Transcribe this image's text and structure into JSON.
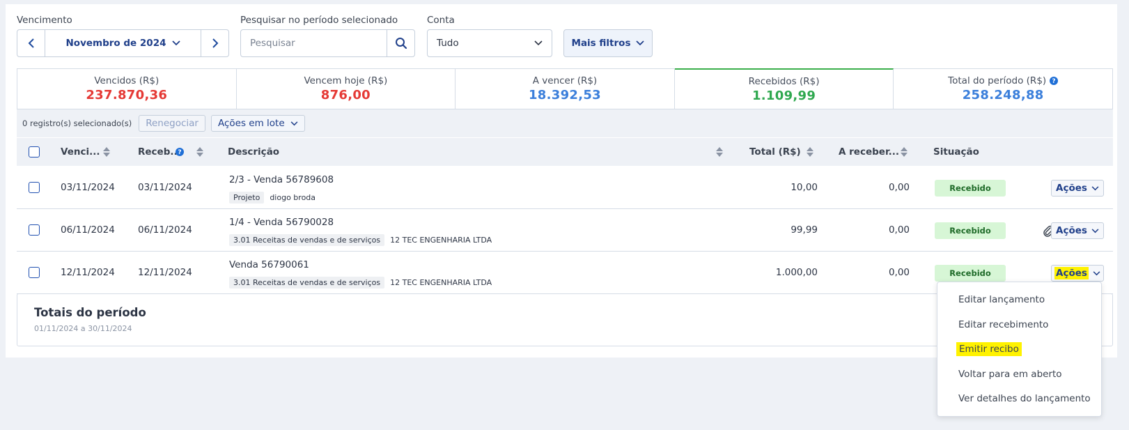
{
  "filters": {
    "vencimento_label": "Vencimento",
    "period_label": "Novembro de 2024",
    "search_label": "Pesquisar no período selecionado",
    "search_placeholder": "Pesquisar",
    "conta_label": "Conta",
    "conta_value": "Tudo",
    "mais_filtros": "Mais filtros"
  },
  "summary": [
    {
      "label": "Vencidos (R$)",
      "value": "237.870,36",
      "color": "#e53935"
    },
    {
      "label": "Vencem hoje (R$)",
      "value": "876,00",
      "color": "#e53935"
    },
    {
      "label": "A vencer (R$)",
      "value": "18.392,53",
      "color": "#3b7fdb"
    },
    {
      "label": "Recebidos (R$)",
      "value": "1.109,99",
      "color": "#2fa84f"
    },
    {
      "label": "Total do período (R$)",
      "value": "258.248,88",
      "color": "#3b7fdb"
    }
  ],
  "toolbar": {
    "selected": "0 registro(s) selecionado(s)",
    "renegociar": "Renegociar",
    "acoes_lote": "Ações em lote"
  },
  "table": {
    "headers": {
      "vencimento": "Venci...",
      "recebimento": "Receb...",
      "descricao": "Descrição",
      "total": "Total (R$)",
      "a_receber": "A receber...",
      "situacao": "Situação"
    },
    "rows": [
      {
        "venc": "03/11/2024",
        "receb": "03/11/2024",
        "desc": "2/3 - Venda 56789608",
        "tag": "Projeto",
        "client": "diogo broda",
        "total": "10,00",
        "a_receber": "0,00",
        "status": "Recebido",
        "acoes": "Ações"
      },
      {
        "venc": "06/11/2024",
        "receb": "06/11/2024",
        "desc": "1/4 - Venda 56790028",
        "tag": "3.01 Receitas de vendas e de serviços",
        "client": "12 TEC ENGENHARIA LTDA",
        "total": "99,99",
        "a_receber": "0,00",
        "status": "Recebido",
        "acoes": "Ações"
      },
      {
        "venc": "12/11/2024",
        "receb": "12/11/2024",
        "desc": "Venda 56790061",
        "tag": "3.01 Receitas de vendas e de serviços",
        "client": "12 TEC ENGENHARIA LTDA",
        "total": "1.000,00",
        "a_receber": "0,00",
        "status": "Recebido",
        "acoes": "Ações"
      }
    ]
  },
  "totais": {
    "title": "Totais do período",
    "range": "01/11/2024 a 30/11/2024"
  },
  "menu": {
    "items": [
      "Editar lançamento",
      "Editar recebimento",
      "Emitir recibo",
      "Voltar para em aberto",
      "Ver detalhes do lançamento"
    ]
  },
  "colors": {
    "accent": "#1f3f8a",
    "highlight": "#fff200",
    "status_bg": "#d7f6d6"
  }
}
